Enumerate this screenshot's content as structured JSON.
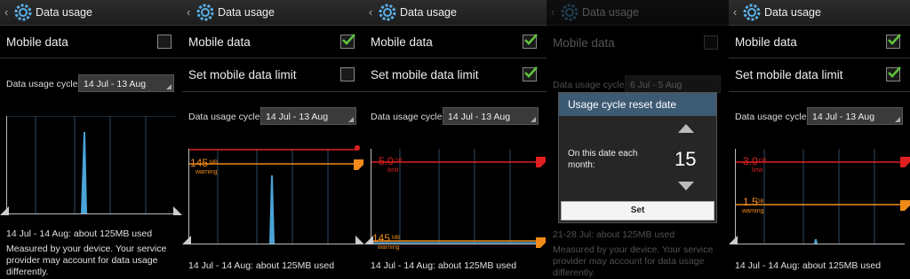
{
  "common": {
    "title": "Data usage",
    "mobile_data": "Mobile data",
    "set_limit": "Set mobile data limit",
    "cycle_label": "Data usage cycle",
    "footer_used": "14 Jul - 14 Aug: about 125MB used",
    "footer_note": "Measured by your device. Your service provider may account for data usage differently."
  },
  "panels": [
    {
      "cycle_value": "14 Jul - 13 Aug",
      "mobile_data_checked": false
    },
    {
      "cycle_value": "14 Jul - 13 Aug",
      "mobile_data_checked": true,
      "limit_checked": true,
      "warning": "145",
      "warning_unit": "MB",
      "warning_label": "warning"
    },
    {
      "cycle_value": "14 Jul - 13 Aug",
      "mobile_data_checked": true,
      "limit_checked": true,
      "limit": "5.0",
      "limit_unit": "GB",
      "limit_label": "limit",
      "warning": "145",
      "warning_unit": "MB",
      "warning_label": "warning"
    },
    {
      "cycle_value": "6 Jul - 5 Aug",
      "footer_used": "21-28 Jul: about 125MB used"
    },
    {
      "cycle_value": "14 Jul - 13 Aug",
      "mobile_data_checked": true,
      "limit_checked": true,
      "limit": "3.0",
      "limit_unit": "GB",
      "limit_label": "limit",
      "warning": "1.5",
      "warning_unit": "GB",
      "warning_label": "warning"
    }
  ],
  "dialog": {
    "title": "Usage cycle reset date",
    "text": "On this date each month:",
    "value": "15",
    "set": "Set"
  },
  "colors": {
    "accent": "#4aa3d6",
    "limit": "#e02020",
    "warning": "#f08a1a",
    "check": "#5ec43a"
  }
}
